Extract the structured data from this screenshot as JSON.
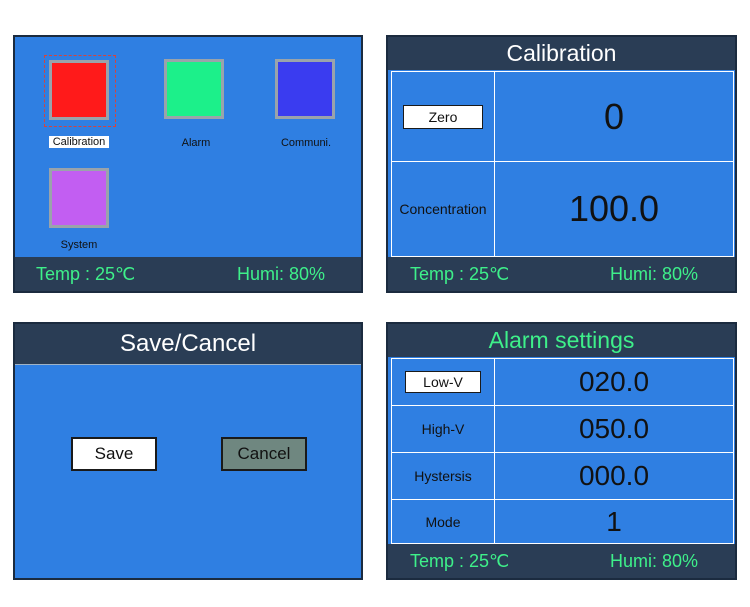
{
  "colors": {
    "panel_bg": "#2f7fe2",
    "bar_bg": "#2a3d55",
    "status_text": "#3ef08a",
    "tile_calibration": "#ff1a1a",
    "tile_alarm": "#1cf08a",
    "tile_communi": "#3a3cf0",
    "tile_system": "#c25ef2",
    "cancel_bg": "#6f8780"
  },
  "status": {
    "temp": "Temp : 25℃",
    "humi": "Humi: 80%"
  },
  "menu": {
    "items": [
      {
        "label": "Calibration",
        "icon": "red-square-icon",
        "selected": true
      },
      {
        "label": "Alarm",
        "icon": "green-square-icon",
        "selected": false
      },
      {
        "label": "Communi.",
        "icon": "blue-square-icon",
        "selected": false
      },
      {
        "label": "System",
        "icon": "purple-square-icon",
        "selected": false
      }
    ]
  },
  "calibration": {
    "title": "Calibration",
    "rows": [
      {
        "label": "Zero",
        "value": "0"
      },
      {
        "label": "Concentration",
        "value": "100.0"
      }
    ]
  },
  "save_cancel": {
    "title": "Save/Cancel",
    "save_label": "Save",
    "cancel_label": "Cancel"
  },
  "alarm": {
    "title": "Alarm settings",
    "rows": [
      {
        "label": "Low-V",
        "value": "020.0"
      },
      {
        "label": "High-V",
        "value": "050.0"
      },
      {
        "label": "Hystersis",
        "value": "000.0"
      },
      {
        "label": "Mode",
        "value": "1"
      }
    ]
  }
}
